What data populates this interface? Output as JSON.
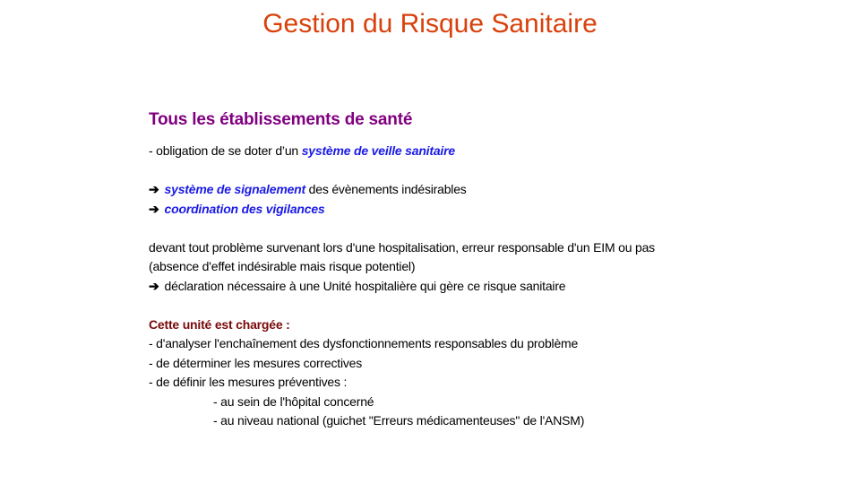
{
  "slide": {
    "title": "Gestion du Risque Sanitaire",
    "heading": "Tous les établissements de santé",
    "obligation_prefix": "- obligation  de se doter  d’un ",
    "obligation_emph": "système de veille sanitaire",
    "arrow_glyph": "➔",
    "signalement_emph": "système de signalement",
    "signalement_rest": " des évènements indésirables",
    "coordination_emph": "coordination des vigilances",
    "para_line1": "devant tout problème survenant lors d'une hospitalisation,  erreur responsable d'un EIM ou pas",
    "para_line2": "(absence d'effet indésirable mais risque potentiel)",
    "declaration": "déclaration nécessaire à une Unité hospitalière qui gère ce risque sanitaire",
    "unit_heading": "Cette unité est chargée :",
    "tasks": [
      "- d'analyser l'enchaînement  des dysfonctionnements  responsables du problème",
      "- de déterminer les mesures correctives",
      "- de définir les mesures préventives  :"
    ],
    "sub_tasks": [
      "- au sein de l'hôpital concerné",
      "- au niveau national  (guichet \"Erreurs médicamenteuses\"  de l'ANSM)"
    ]
  }
}
